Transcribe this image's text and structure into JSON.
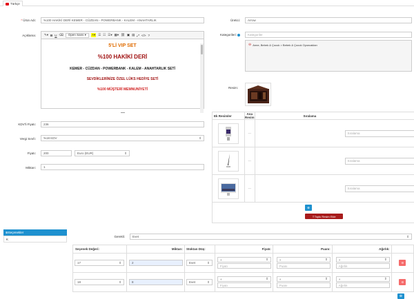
{
  "tab": {
    "label": "Türkçe"
  },
  "form": {
    "urun_adi_label": "Ürün Adı:",
    "urun_adi_value": "%100 HAKİKİ DERİ KEMER - CÜZDAN - POWERBANK - KALEM - ANAHTARLIK",
    "aciklama_label": "Açıklama:",
    "uretici_label": "Üretici:",
    "uretici_value": "Arrow",
    "kategoriler_label": "Kategorileri:",
    "kategoriler_placeholder": "Kategoriler",
    "kategori_item": "Anne, Bebek & Çocuk > Bebek & Çocuk Oyuncakları",
    "resim_label": "Resim:",
    "kdv_fiyat_label": "KDV'li Fiyatı:",
    "kdv_fiyat_value": "236",
    "vergi_label": "Vergi Sınıfı:",
    "vergi_value": "%18 KDV",
    "fiyat_label": "Fiyatı:",
    "fiyat_value": "200",
    "para_birimi": "Euro (EUR)",
    "miktar_label": "Miktarı:",
    "miktar_value": "1"
  },
  "editor": {
    "toolbar": [
      "✎",
      "B",
      "U",
      "⌫",
      "Open Sans ▾",
      "A",
      "≡",
      "≡",
      "≡",
      "≡",
      "🔗",
      "▣",
      "▤",
      "⤢",
      "</>",
      "?"
    ],
    "lines": [
      {
        "text": "5'Lİ VIP SET",
        "color": "#e06c00",
        "size": "7px"
      },
      {
        "text": "%100 HAKİKİ DERİ",
        "color": "#a01010",
        "size": "8px"
      },
      {
        "text": "KEMER - CÜZDAN - POWERBANK - KALEM - ANAHTARLIK SETİ",
        "color": "#111111",
        "size": "5px"
      },
      {
        "text": "SEVDİKLERİNİZE ÖZEL LÜKS HEDİYE SETİ",
        "color": "#a01010",
        "size": "5px"
      },
      {
        "text": "%100 MÜŞTERİ MEMNUNİYETİ",
        "color": "#d02020",
        "size": "5px"
      }
    ]
  },
  "ek_resimler": {
    "headers": [
      "Ek Resimler",
      "Ana Resim",
      "Sıralama"
    ],
    "rows": [
      {
        "ana": "---",
        "siralama_placeholder": "Sıralama"
      },
      {
        "ana": "---",
        "siralama_placeholder": "Sıralama"
      },
      {
        "ana": "---",
        "siralama_placeholder": "Sıralama"
      }
    ],
    "toplu_button": "Toplu Resim Ekle"
  },
  "secenekler": {
    "tab_label": "Seçenekler",
    "item": "K",
    "gerekli_label": "Gerekli:",
    "gerekli_value": "Evet",
    "headers": [
      "Seçenek Değeri:",
      "Miktarı:",
      "Stoktan Düş:",
      "Fiyatı:",
      "Puanı:",
      "Ağırlık:"
    ],
    "rows": [
      {
        "deger": "17",
        "miktar": "2",
        "stok": "Evet",
        "fiyat_op": "+",
        "fiyat_ph": "Fiyatı",
        "puan_op": "+",
        "puan_ph": "Puanı",
        "agirlik_op": "+",
        "agirlik_ph": "Ağırlık"
      },
      {
        "deger": "18",
        "miktar": "8",
        "stok": "Evet",
        "fiyat_op": "+",
        "fiyat_ph": "Fiyatı",
        "puan_op": "+",
        "puan_ph": "Puanı",
        "agirlik_op": "+",
        "agirlik_ph": "Ağırlık"
      }
    ]
  },
  "colors": {
    "accent": "#1e91cf",
    "danger": "#f56b6b",
    "required": "#ee3333"
  }
}
